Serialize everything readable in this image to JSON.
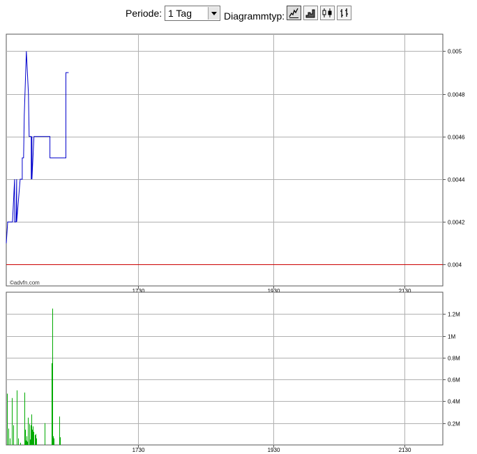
{
  "toolbar": {
    "period_label": "Periode:",
    "period_value": "1 Tag",
    "chart_type_label": "Diagrammtyp:",
    "chart_types": [
      "line-chart-icon",
      "area-chart-icon",
      "candlestick-chart-icon",
      "ohlc-bar-chart-icon"
    ],
    "active_chart_type": 0
  },
  "watermark": "©advfn.com",
  "colors": {
    "price_line": "#0000cc",
    "volume_bar": "#00aa00",
    "reference_line": "#cc0000",
    "grid": "#b0b0b0"
  },
  "chart_data": [
    {
      "type": "line",
      "name": "price",
      "x": [
        0,
        2,
        3,
        9,
        12,
        12,
        13,
        14,
        15,
        15,
        20,
        22,
        23,
        23,
        24,
        25,
        26,
        26,
        27,
        27,
        28,
        28,
        29,
        29,
        32,
        33,
        34,
        34,
        35,
        36,
        36,
        37,
        37,
        40,
        49,
        50,
        50,
        62,
        63,
        63,
        64,
        65,
        70,
        75,
        76,
        77,
        78,
        80,
        84,
        86,
        86,
        87,
        90
      ],
      "y": [
        0.0041,
        0.0042,
        0.0042,
        0.0042,
        0.0044,
        0.0042,
        0.0042,
        0.0042,
        0.0044,
        0.0042,
        0.0044,
        0.0044,
        0.0044,
        0.0045,
        0.0045,
        0.0045,
        0.0047,
        0.0047,
        0.0048,
        0.0048,
        0.0049,
        0.0049,
        0.005,
        0.005,
        0.0048,
        0.0046,
        0.0046,
        0.0046,
        0.0046,
        0.0046,
        0.0044,
        0.0046,
        0.0044,
        0.0046,
        0.0046,
        0.0046,
        0.0046,
        0.0046,
        0.0046,
        0.0045,
        0.0045,
        0.0045,
        0.0045,
        0.0045,
        0.0045,
        0.0045,
        0.0045,
        0.0045,
        0.0045,
        0.0045,
        0.0049,
        0.0049,
        0.0049
      ],
      "x_ticks": [
        {
          "x": 190,
          "label": "1730"
        },
        {
          "x": 385,
          "label": "1930"
        },
        {
          "x": 575,
          "label": "2130"
        }
      ],
      "xlim": [
        0,
        630
      ],
      "y_ticks": [
        0.004,
        0.0042,
        0.0044,
        0.0046,
        0.0048,
        0.005
      ],
      "y_tick_labels": [
        "0.004",
        "0.0042",
        "0.0044",
        "0.0046",
        "0.0048",
        "0.005"
      ],
      "ylim": [
        0.0039,
        0.00508
      ],
      "reference_line": 0.004,
      "grid": true
    },
    {
      "type": "bar",
      "name": "volume",
      "x": [
        1,
        3,
        5,
        8,
        10,
        15,
        17,
        20,
        26,
        27,
        28,
        29,
        30,
        31,
        33,
        34,
        35,
        36,
        37,
        38,
        39,
        41,
        42,
        43,
        55,
        65,
        66,
        67,
        68,
        76,
        77
      ],
      "values": [
        470000,
        150000,
        60000,
        430000,
        180000,
        500000,
        60000,
        20000,
        480000,
        140000,
        40000,
        80000,
        30000,
        250000,
        190000,
        50000,
        180000,
        280000,
        140000,
        170000,
        120000,
        90000,
        100000,
        60000,
        200000,
        750000,
        1250000,
        80000,
        60000,
        260000,
        70000
      ],
      "x_ticks": [
        {
          "x": 190,
          "label": "1730"
        },
        {
          "x": 385,
          "label": "1930"
        },
        {
          "x": 575,
          "label": "2130"
        }
      ],
      "xlim": [
        0,
        630
      ],
      "y_ticks": [
        200000,
        400000,
        600000,
        800000,
        1000000,
        1200000
      ],
      "y_tick_labels": [
        "0.2M",
        "0.4M",
        "0.6M",
        "0.8M",
        "1M",
        "1.2M"
      ],
      "ylim": [
        0,
        1400000
      ],
      "grid": true
    }
  ]
}
